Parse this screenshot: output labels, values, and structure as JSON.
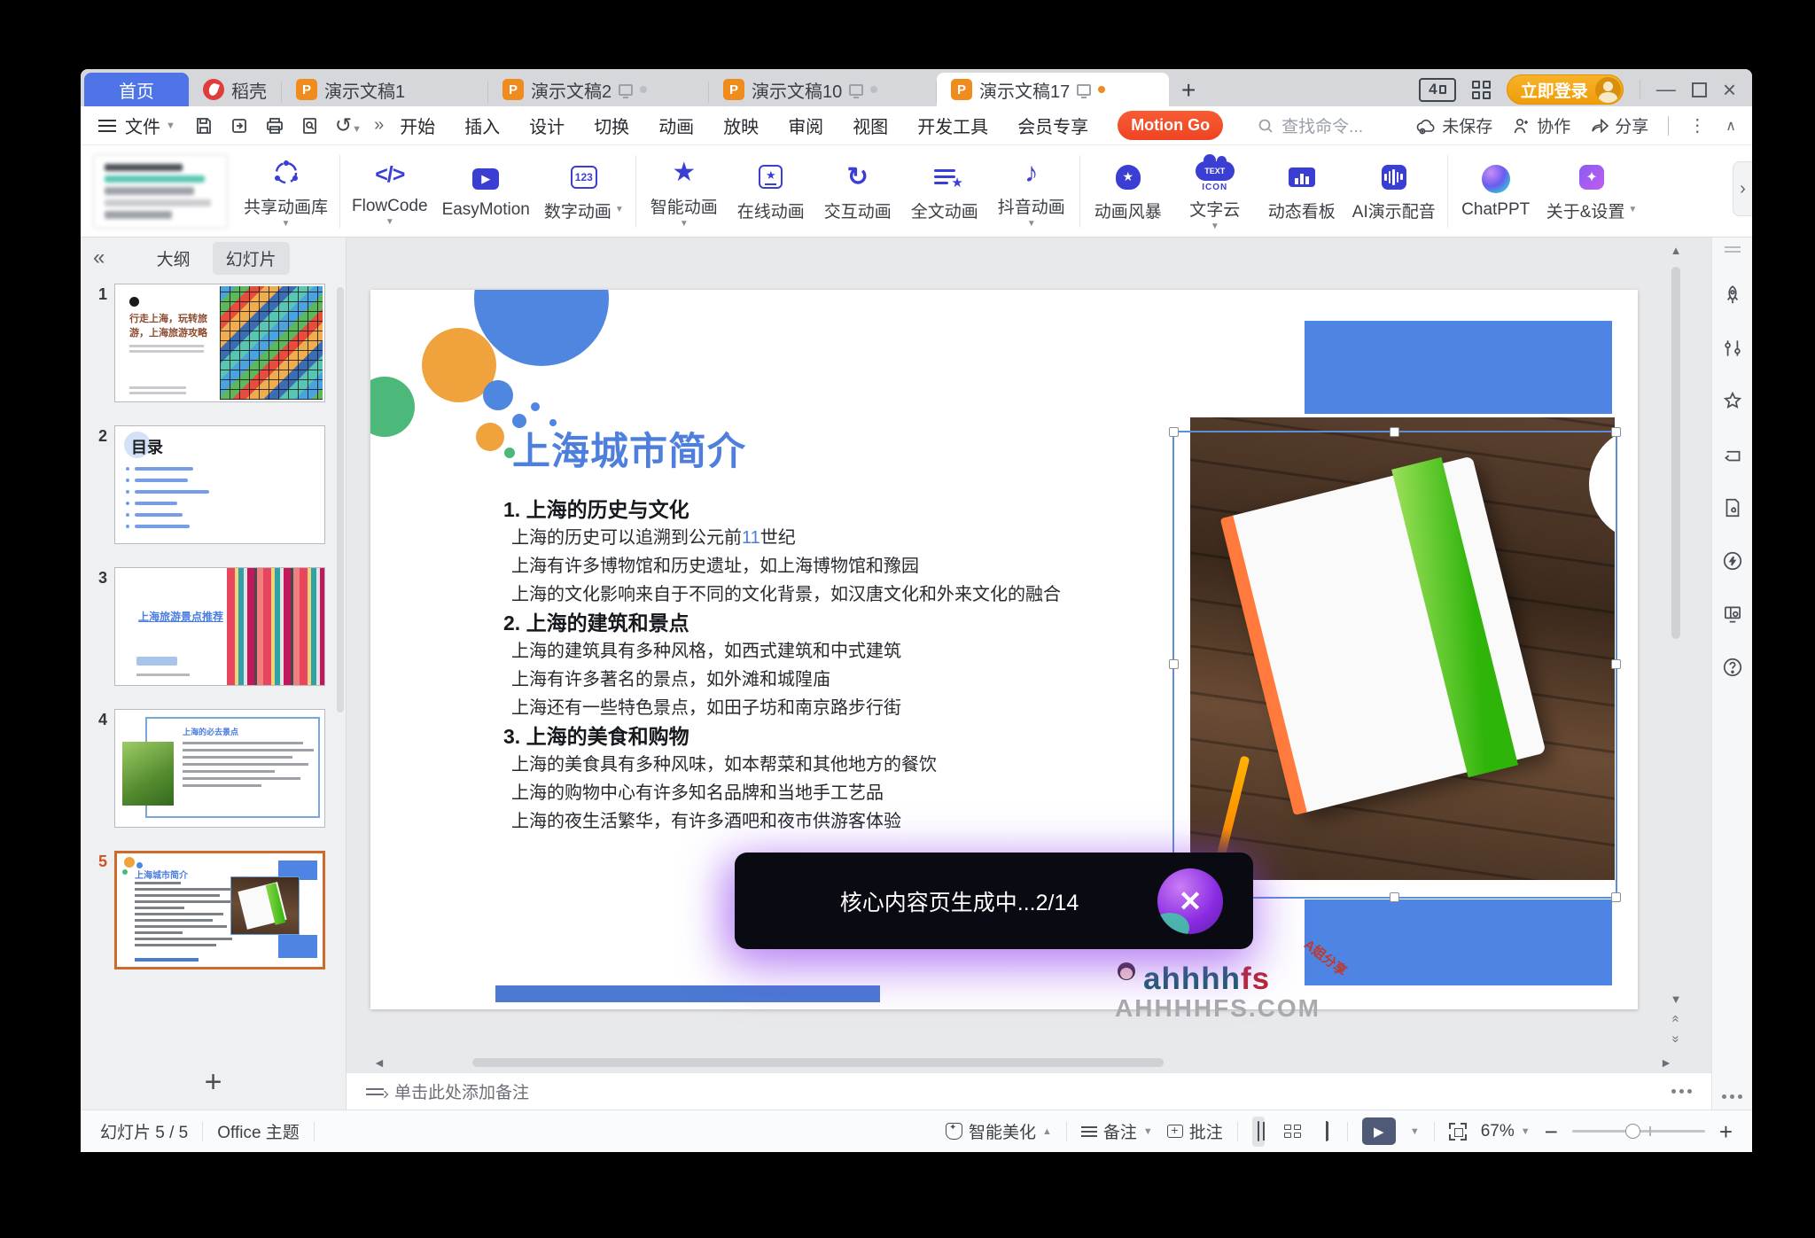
{
  "titlebar": {
    "multi_window_badge": "4",
    "login": "立即登录"
  },
  "tabs": {
    "home": "首页",
    "docer": "稻壳",
    "doc1": "演示文稿1",
    "doc2": "演示文稿2",
    "doc10": "演示文稿10",
    "doc17": "演示文稿17"
  },
  "menubar": {
    "file": "文件",
    "items": [
      "开始",
      "插入",
      "设计",
      "切换",
      "动画",
      "放映",
      "审阅",
      "视图",
      "开发工具",
      "会员专享"
    ],
    "motion_go": "Motion Go",
    "search_placeholder": "查找命令...",
    "unsaved": "未保存",
    "collab": "协作",
    "share": "分享"
  },
  "ribbon": {
    "share_lib": "共享动画库",
    "flowcode": "FlowCode",
    "easymotion": "EasyMotion",
    "digital": "数字动画",
    "smart": "智能动画",
    "online": "在线动画",
    "interactive": "交互动画",
    "fulltext": "全文动画",
    "douyin": "抖音动画",
    "storm": "动画风暴",
    "wordcloud": "文字云",
    "cloud_text": "TEXT",
    "cloud_sub": "ICON",
    "kanban": "动态看板",
    "ai_voice": "AI演示配音",
    "chatppt": "ChatPPT",
    "about": "关于&设置"
  },
  "left_panel": {
    "outline_tab": "大纲",
    "slides_tab": "幻灯片",
    "slides": [
      {
        "num": "1",
        "title": "行走上海，玩转旅游，上海旅游攻略"
      },
      {
        "num": "2",
        "title": "目录"
      },
      {
        "num": "3",
        "title": "上海旅游景点推荐"
      },
      {
        "num": "4",
        "title": "上海的必去景点"
      },
      {
        "num": "5",
        "title": "上海城市简介"
      }
    ]
  },
  "slide": {
    "title": "上海城市简介",
    "s1_heading": "1. 上海的历史与文化",
    "s1_l1_pre": "上海的历史可以追溯到公元前",
    "s1_l1_num": "11",
    "s1_l1_post": "世纪",
    "s1_l2": "上海有许多博物馆和历史遗址，如上海博物馆和豫园",
    "s1_l3": "上海的文化影响来自于不同的文化背景，如汉唐文化和外来文化的融合",
    "s2_heading": "2. 上海的建筑和景点",
    "s2_l1": "上海的建筑具有多种风格，如西式建筑和中式建筑",
    "s2_l2": "上海有许多著名的景点，如外滩和城隍庙",
    "s2_l3": "上海还有一些特色景点，如田子坊和南京路步行街",
    "s3_heading": "3. 上海的美食和购物",
    "s3_l1": "上海的美食具有多种风味，如本帮菜和其他地方的餐饮",
    "s3_l2": "上海的购物中心有许多知名品牌和当地手工艺品",
    "s3_l3": "上海的夜生活繁华，有许多酒吧和夜市供游客体验"
  },
  "toast": {
    "message": "核心内容页生成中...2/14"
  },
  "watermark": {
    "logo_main": "ahhhh",
    "logo_accent": "fs",
    "badge": "A姐分享",
    "domain": "AHHHHFS.COM"
  },
  "notes": {
    "placeholder": "单击此处添加备注"
  },
  "statusbar": {
    "counter": "幻灯片 5 / 5",
    "theme": "Office 主题",
    "beautify": "智能美化",
    "note": "备注",
    "comment": "批注",
    "zoom": "67%"
  },
  "colors": {
    "accent_blue": "#4e74e8",
    "slide_blue": "#4e84e4",
    "ribbon_icon": "#3b3ed2",
    "tab_orange": "#f08c1e",
    "motion_go": "#ef4423",
    "selected_thumb_border": "#cf6a2d",
    "toast_bg": "#0a0a12"
  }
}
